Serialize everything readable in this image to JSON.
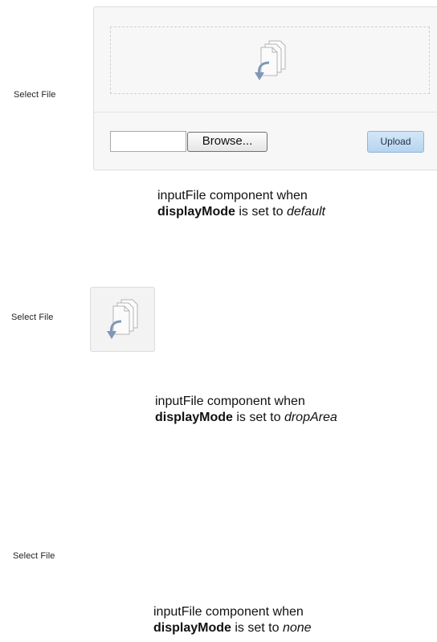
{
  "examples": [
    {
      "mode": "default",
      "label": "Select File",
      "browse_label": "Browse...",
      "upload_label": "Upload",
      "caption": {
        "line1": "inputFile component when",
        "prop": "displayMode",
        "mid": " is set to ",
        "value": "default"
      }
    },
    {
      "mode": "dropArea",
      "label": "Select File",
      "caption": {
        "line1": "inputFile component when",
        "prop": "displayMode",
        "mid": " is set to ",
        "value": "dropArea"
      }
    },
    {
      "mode": "none",
      "label": "Select File",
      "caption": {
        "line1": "inputFile component when",
        "prop": "displayMode",
        "mid": " is set to ",
        "value": "none"
      }
    }
  ],
  "icons": {
    "drop": "file-drop-icon"
  },
  "colors": {
    "upload_button": "#b6d4ef",
    "panel_background": "#f7f7f7",
    "icon_arrow": "#7f97b8"
  }
}
